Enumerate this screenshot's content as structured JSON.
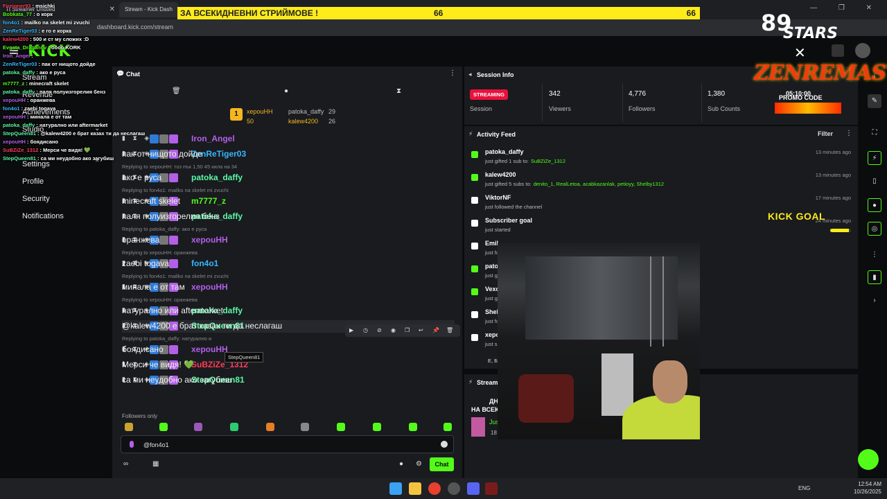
{
  "browser": {
    "tab1_title": "Tt Streamer Untitled",
    "tab2_title": "Stream - Kick Dash",
    "url": "dashboard.kick.com/stream"
  },
  "header": {
    "logo": "KICK"
  },
  "sidebar": {
    "items": [
      "Stream",
      "Revenue",
      "Achievements",
      "Studio",
      "Settings",
      "Profile",
      "Security",
      "Notifications"
    ]
  },
  "chat": {
    "title": "Chat",
    "pinned": {
      "leader_name": "xepouHH",
      "leader_count": "50",
      "second_name": "patoka_daffy",
      "second_count": "29",
      "third_name": "kalew4200",
      "third_count": "26",
      "rank": "1"
    },
    "messages": [
      {
        "reply": "",
        "user": "Iron_Angel",
        "text": "",
        "color": "#b45fe8"
      },
      {
        "reply": "",
        "user": "ZenReTiger03",
        "text": "пак от нищото дойде",
        "color": "#37b7ff"
      },
      {
        "reply": "Replying to xepouHH: тоз пък 1,50 45 кила на 34",
        "user": "patoka_daffy",
        "text": "ако е руса",
        "color": "#5bf8a5"
      },
      {
        "reply": "Replying to fon4o1: mailko na skelet mi zvuchi",
        "user": "m7777_z",
        "text": "minecraft skelet",
        "color": "#53fc18"
      },
      {
        "reply": "",
        "user": "patoka_daffy",
        "text": "паля полуизгорелия бенз",
        "color": "#5bf8a5"
      },
      {
        "reply": "Replying to patoka_daffy: ако е руса",
        "user": "xepouHH",
        "text": "оранжева",
        "color": "#b45fe8"
      },
      {
        "reply": "Replying to xepouHH: оранжева",
        "user": "fon4o1",
        "text": "zaebi togava",
        "color": "#37b7ff"
      },
      {
        "reply": "Replying to fon4o1: mailko na skelet mi zvuchi",
        "user": "xepouHH",
        "text": "минала е от там",
        "color": "#b45fe8"
      },
      {
        "reply": "Replying to xepouHH: оранжева",
        "user": "patoka_daffy",
        "text": "натурално или aftermarket",
        "color": "#5bf8a5"
      },
      {
        "reply": "",
        "user": "StepQueen81",
        "text": "@kalew4200 е брат казах ти да неслагаш",
        "color": "#5bf8a5"
      },
      {
        "reply": "Replying to patoka_daffy: натурално и",
        "user": "xepouHH",
        "text": "боядисано",
        "color": "#b45fe8"
      },
      {
        "reply": "",
        "user": "SuBZiZe_1312",
        "text": "Мерси че видя! 💚",
        "color": "#ff3d5a"
      },
      {
        "reply": "",
        "user": "StepQueen81",
        "text": "са ми неудобно ако загубиш",
        "color": "#5bf8a5"
      }
    ],
    "tooltip": "StepQueen81",
    "followers_only": "Followers only",
    "input_value": "@fon4o1",
    "send_label": "Chat"
  },
  "session": {
    "title": "Session Info",
    "status": "STREAMING",
    "session_label": "Session",
    "viewers": "342",
    "viewers_label": "Viewers",
    "followers": "4,776",
    "followers_label": "Followers",
    "subs": "1,380",
    "subs_label": "Sub Counts"
  },
  "activity": {
    "title": "Activity Feed",
    "filter": "Filter",
    "items": [
      {
        "name": "patoka_daffy",
        "sub": "just gifted 1 sub to:",
        "highlight": "SuBZiZe_1312",
        "time": "13 minutes ago",
        "color": "#53fc18"
      },
      {
        "name": "kalew4200",
        "sub": "just gifted 5 subs to:",
        "highlight": "denito_1, RealLetoa, acabkazanlak, petioyy, Shelby1312",
        "time": "13 minutes ago",
        "color": "#53fc18"
      },
      {
        "name": "ViktorNF",
        "sub": "just followed the channel",
        "highlight": "",
        "time": "17 minutes ago",
        "color": "#ffffff"
      },
      {
        "name": "Subscriber goal",
        "sub": "just started",
        "highlight": "",
        "time": "24 minutes ago",
        "color": "#ffffff"
      },
      {
        "name": "Emil",
        "sub": "just fo",
        "highlight": "",
        "time": "",
        "color": "#ffffff"
      },
      {
        "name": "pato",
        "sub": "just g",
        "highlight": "",
        "time": "",
        "color": "#53fc18"
      },
      {
        "name": "Vexo",
        "sub": "just g",
        "highlight": "",
        "time": "",
        "color": "#53fc18"
      },
      {
        "name": "Shell",
        "sub": "just fo",
        "highlight": "",
        "time": "",
        "color": "#ffffff"
      },
      {
        "name": "xepo",
        "sub": "just s",
        "highlight": "",
        "time": "",
        "color": "#ffffff"
      }
    ],
    "footer": "E, Б"
  },
  "stream_panel": {
    "title": "Stream",
    "line1": "ДН",
    "line2": "НА ВСЕК",
    "user": "Jus",
    "num": "18"
  },
  "overlay": {
    "banner_text": "ЗА ВСЕКИДНЕВНИ СТРИЙМОВЕ !",
    "banner_num1": "66",
    "banner_num2": "66",
    "brand_num": "89",
    "brand_word": "STARS",
    "zen": "ZENREMASTA",
    "zen_time": "05:10:00",
    "zen_promo": "PROMO CODE",
    "kick_goal": "KICK GOAL",
    "goal_progress": 0.9,
    "chat_lines": [
      {
        "name": "Fireigner93",
        "text": "msichki",
        "color": "#ff3d5a"
      },
      {
        "name": "Bobkata_77",
        "text": "о корк",
        "color": "#53fc18"
      },
      {
        "name": "fon4o1",
        "text": "mailko na skelet mi zvuchi",
        "color": "#37b7ff"
      },
      {
        "name": "ZenReTiger03",
        "text": "е го е корка",
        "color": "#37b7ff"
      },
      {
        "name": "kalew4200",
        "text": "500 и ст му сложих :D",
        "color": "#ff3d5a"
      },
      {
        "name": "Evgata_Draganov",
        "text": "оооо KORK",
        "color": "#53fc18"
      },
      {
        "name": "Iron_Angel",
        "text": "",
        "color": "#b45fe8"
      },
      {
        "name": "ZenReTiger03",
        "text": "пак от нищото дойде",
        "color": "#37b7ff"
      },
      {
        "name": "patoka_daffy",
        "text": "ако е руса",
        "color": "#5bf8a5"
      },
      {
        "name": "m7777_z",
        "text": "minecraft skelet",
        "color": "#53fc18"
      },
      {
        "name": "patoka_daffy",
        "text": "паля полуизгорелия бенз",
        "color": "#5bf8a5"
      },
      {
        "name": "xepouHH",
        "text": "оранжева",
        "color": "#b45fe8"
      },
      {
        "name": "fon4o1",
        "text": "zaebi togava",
        "color": "#37b7ff"
      },
      {
        "name": "xepouHH",
        "text": "минала е от там",
        "color": "#b45fe8"
      },
      {
        "name": "patoka_daffy",
        "text": "натурално или aftermarket",
        "color": "#5bf8a5"
      },
      {
        "name": "StepQueen81",
        "text": "@kalew4200 е брат казах ти да неслагаш",
        "color": "#5bf8a5"
      },
      {
        "name": "xepouHH",
        "text": "боядисано",
        "color": "#b45fe8"
      },
      {
        "name": "SuBZiZe_1312",
        "text": "Мерси че видя! 💚",
        "color": "#ff3d5a"
      },
      {
        "name": "StepQueen81",
        "text": "са ми неудобно ако загубиш",
        "color": "#5bf8a5"
      }
    ]
  },
  "taskbar": {
    "lang": "ENG",
    "time": "12:54 AM",
    "date": "10/26/2025"
  }
}
